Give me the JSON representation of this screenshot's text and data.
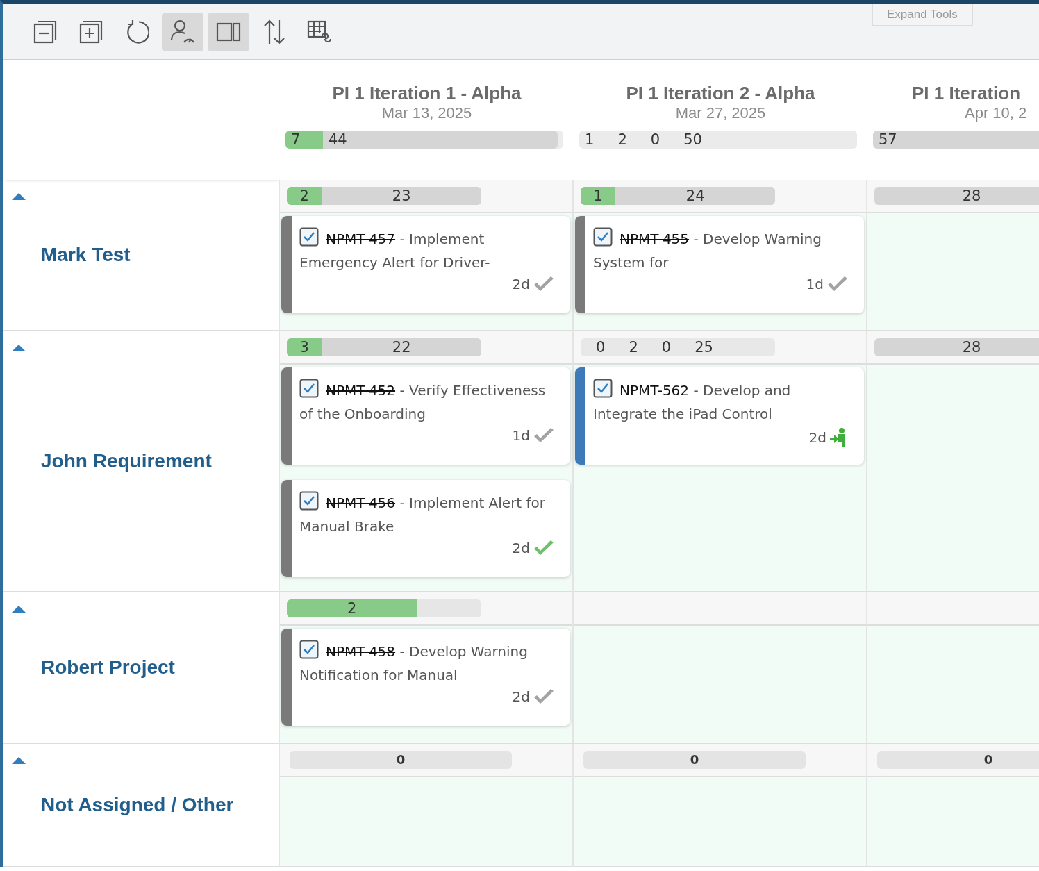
{
  "toolbar": {
    "tools": [
      {
        "kind": "collapse",
        "selected": false
      },
      {
        "kind": "expand",
        "selected": false
      },
      {
        "kind": "refresh",
        "selected": false
      },
      {
        "kind": "person-gauge",
        "selected": true
      },
      {
        "kind": "columns",
        "selected": true
      },
      {
        "kind": "sort",
        "selected": false
      },
      {
        "kind": "table-link",
        "selected": false
      }
    ],
    "expand_button": "Expand Tools"
  },
  "iterations": [
    {
      "title": "PI 1 Iteration 1 - Alpha",
      "date": "Mar 13, 2025",
      "bar": {
        "kind": "split",
        "level": 0.135,
        "labels": [
          "7",
          "44"
        ]
      }
    },
    {
      "title": "PI 1 Iteration 2 - Alpha",
      "date": "Mar 27, 2025",
      "bar": {
        "kind": "plain",
        "labels": [
          "1",
          "2",
          "0",
          "50"
        ]
      }
    },
    {
      "title": "PI 1 Iteration",
      "date": "Apr 10, 2",
      "bar": {
        "kind": "left",
        "labels": [
          "57"
        ]
      }
    }
  ],
  "rows": [
    {
      "name": "Mark Test",
      "expanded": true,
      "cells": [
        {
          "bar": {
            "kind": "split",
            "level": 0.18,
            "labels": [
              "2",
              "23"
            ]
          },
          "cards": [
            {
              "id": "NPMT-457",
              "done": true,
              "checked": true,
              "title": "- Implement Emergency Alert for Driver-",
              "estimate": "2d",
              "status": {
                "kind": "check-grey"
              },
              "color": "#7a7a7a"
            }
          ]
        },
        {
          "bar": {
            "kind": "split",
            "level": 0.18,
            "labels": [
              "1",
              "24"
            ]
          },
          "cards": [
            {
              "id": "NPMT-455",
              "done": true,
              "checked": true,
              "title": "- Develop Warning System for",
              "estimate": "1d",
              "status": {
                "kind": "check-grey"
              },
              "color": "#7a7a7a"
            }
          ]
        },
        {
          "bar": {
            "kind": "total",
            "labels": [
              "28"
            ]
          }
        }
      ]
    },
    {
      "name": "John Requirement",
      "expanded": true,
      "cells": [
        {
          "bar": {
            "kind": "split",
            "level": 0.18,
            "labels": [
              "3",
              "22"
            ]
          },
          "cards": [
            {
              "id": "NPMT-452",
              "done": true,
              "checked": true,
              "title": "- Verify Effectiveness of the Onboarding",
              "estimate": "1d",
              "status": {
                "kind": "check-grey"
              },
              "color": "#7a7a7a"
            },
            {
              "id": "NPMT-456",
              "done": true,
              "checked": true,
              "title": "- Implement Alert for Manual Brake",
              "estimate": "2d",
              "status": {
                "kind": "check-green"
              },
              "color": "#7a7a7a"
            }
          ]
        },
        {
          "bar": {
            "kind": "plain",
            "labels": [
              "0",
              "2",
              "0",
              "25"
            ]
          },
          "cards": [
            {
              "id": "NPMT-562",
              "done": false,
              "checked": true,
              "title": "- Develop and Integrate the iPad Control",
              "estimate": "2d",
              "status": {
                "kind": "person-arrow"
              },
              "color": "#3f7ab8"
            }
          ]
        },
        {
          "bar": {
            "kind": "total",
            "labels": [
              "28"
            ]
          }
        }
      ]
    },
    {
      "name": "Robert Project",
      "expanded": true,
      "cells": [
        {
          "bar": {
            "kind": "fill",
            "level": 0.67,
            "labels": [
              "2"
            ]
          },
          "cards": [
            {
              "id": "NPMT-458",
              "done": true,
              "checked": true,
              "title": "- Develop Warning Notification for Manual",
              "estimate": "2d",
              "status": {
                "kind": "check-grey"
              },
              "color": "#7a7a7a"
            }
          ]
        },
        {},
        {}
      ]
    },
    {
      "name": "Not Assigned / Other",
      "expanded": true,
      "cells": [
        {
          "bar": {
            "kind": "wide",
            "labels": [
              "0"
            ]
          }
        },
        {
          "bar": {
            "kind": "wide",
            "labels": [
              "0"
            ]
          }
        },
        {
          "bar": {
            "kind": "wide",
            "labels": [
              "0"
            ]
          }
        }
      ]
    }
  ]
}
